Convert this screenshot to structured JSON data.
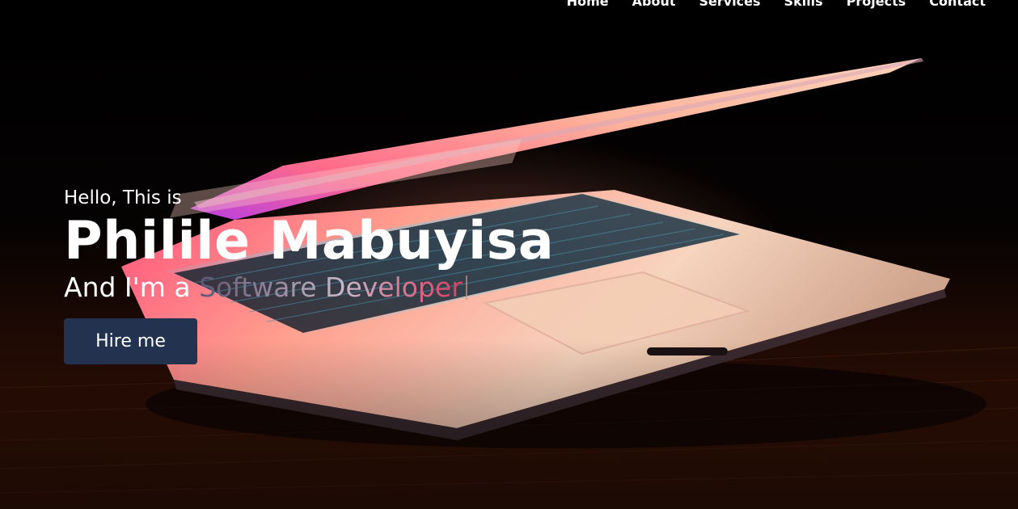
{
  "nav": {
    "items": [
      "Home",
      "About",
      "Services",
      "Skills",
      "Projects",
      "Contact"
    ]
  },
  "hero": {
    "greeting": "Hello, This is",
    "name": "Philile Mabuyisa",
    "tagline_prefix": "And I'm a ",
    "tagline_role": "Software Developer",
    "button_label": "Hire me",
    "background_image": "laptop-icon"
  },
  "colors": {
    "background": "#000000",
    "button": "#22324f",
    "text": "#ffffff",
    "accent": "#e23a5c"
  }
}
